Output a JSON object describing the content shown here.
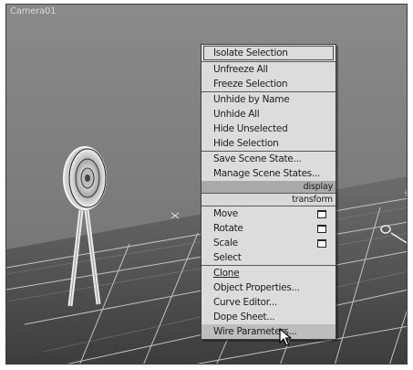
{
  "viewport": {
    "label": "Camera01",
    "colors": {
      "sky": "#7a7a7a",
      "ground": "#5e5e5e",
      "grid": "#d6d6d6"
    }
  },
  "quad_menu": {
    "display_section": [
      {
        "label": "Isolate Selection",
        "boxed": true
      },
      {
        "label": "Unfreeze All"
      },
      {
        "label": "Freeze Selection"
      },
      {
        "label": "Unhide by Name"
      },
      {
        "label": "Unhide All"
      },
      {
        "label": "Hide Unselected"
      },
      {
        "label": "Hide Selection"
      },
      {
        "label": "Save Scene State..."
      },
      {
        "label": "Manage Scene States..."
      }
    ],
    "display_header": "display",
    "transform_header": "transform",
    "transform_section": [
      {
        "label": "Move",
        "check_icon": "square-icon"
      },
      {
        "label": "Rotate",
        "check_icon": "square-icon"
      },
      {
        "label": "Scale",
        "check_icon": "square-icon"
      },
      {
        "label": "Select"
      },
      {
        "label": "Clone"
      },
      {
        "label": "Object Properties..."
      },
      {
        "label": "Curve Editor..."
      },
      {
        "label": "Dope Sheet..."
      },
      {
        "label": "Wire Parameters...",
        "highlighted": true
      }
    ]
  },
  "cursor": "arrow-cursor-icon"
}
